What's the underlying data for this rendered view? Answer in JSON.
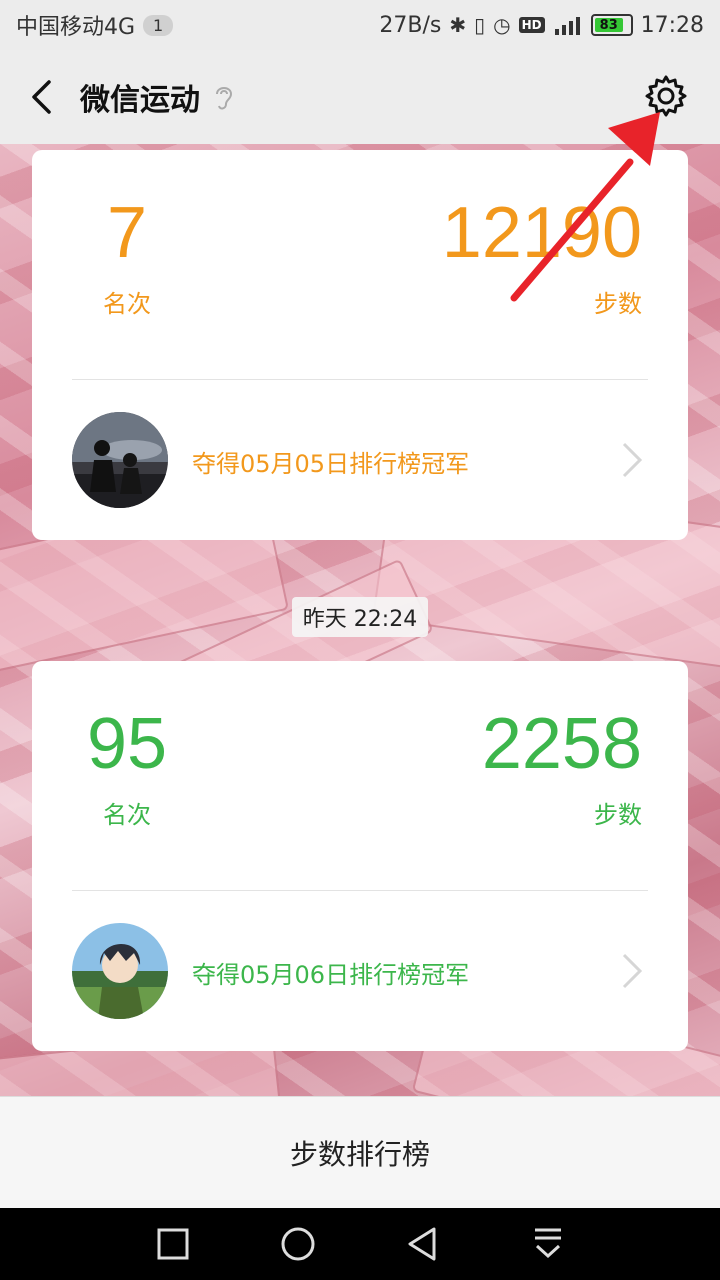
{
  "status_bar": {
    "carrier": "中国移动4G",
    "badge": "1",
    "net_speed": "27B/s",
    "hd": "HD",
    "battery": "83",
    "time": "17:28"
  },
  "header": {
    "title": "微信运动"
  },
  "card_today": {
    "rank": "7",
    "rank_label": "名次",
    "steps": "12190",
    "steps_label": "步数",
    "champion_text": "夺得05月05日排行榜冠军"
  },
  "timestamp": "昨天 22:24",
  "card_yesterday": {
    "rank": "95",
    "rank_label": "名次",
    "steps": "2258",
    "steps_label": "步数",
    "champion_text": "夺得05月06日排行榜冠军"
  },
  "bottom_bar": {
    "label": "步数排行榜"
  },
  "colors": {
    "orange": "#f2981c",
    "green": "#3cb64b",
    "annotation_arrow": "#e8232a"
  }
}
